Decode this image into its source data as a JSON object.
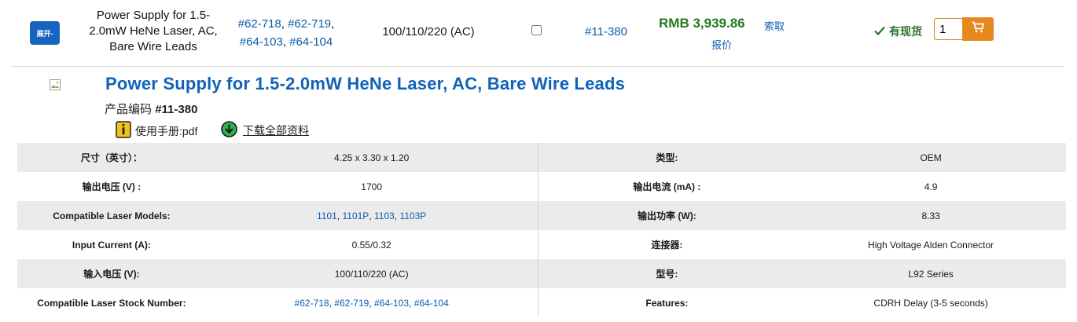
{
  "product_row": {
    "expand_label": "展开-",
    "name": "Power Supply for 1.5-2.0mW HeNe Laser, AC, Bare Wire Leads",
    "variants": [
      "#62-718",
      "#62-719",
      "#64-103",
      "#64-104"
    ],
    "voltage": "100/110/220 (AC)",
    "stock_number": "#11-380",
    "price": "RMB 3,939.86",
    "quote_label_1": "索取",
    "quote_label_2": "报价",
    "stock_status": "有现货",
    "quantity": "1",
    "colors": {
      "price": "#237a21",
      "cart": "#e5891f",
      "expand": "#1764c0"
    },
    "icons": {
      "stock": "check-icon",
      "cart": "cart-icon"
    }
  },
  "detail": {
    "title": "Power Supply for 1.5-2.0mW HeNe Laser, AC, Bare Wire Leads",
    "code_label": "产品编码",
    "code": "#11-380",
    "manual_label": "使用手册:pdf",
    "download_label": "下载全部资料",
    "icons": {
      "manual": "pdf-icon",
      "download": "download-icon",
      "thumb": "broken-image-icon"
    }
  },
  "specs": [
    {
      "l1": "尺寸（英寸）：",
      "v1": "4.25 x 3.30 x 1.20",
      "l2": "类型:",
      "v2": "OEM"
    },
    {
      "l1": "输出电压 (V) :",
      "v1": "1700",
      "l2": "输出电流 (mA) :",
      "v2": "4.9"
    },
    {
      "l1": "Compatible Laser Models:",
      "v1_links": [
        "1101",
        "1101P",
        "1103",
        "1103P"
      ],
      "l2": "输出功率 (W):",
      "v2": "8.33"
    },
    {
      "l1": "Input Current (A):",
      "v1": "0.55/0.32",
      "l2": "连接器:",
      "v2": "High Voltage Alden Connector"
    },
    {
      "l1": "输入电压 (V):",
      "v1": "100/110/220 (AC)",
      "l2": "型号:",
      "v2": "L92 Series"
    },
    {
      "l1": "Compatible Laser Stock Number:",
      "v1_links": [
        "#62-718",
        "#62-719",
        "#64-103",
        "#64-104"
      ],
      "l2": "Features:",
      "v2": "CDRH Delay (3-5 seconds)"
    }
  ]
}
